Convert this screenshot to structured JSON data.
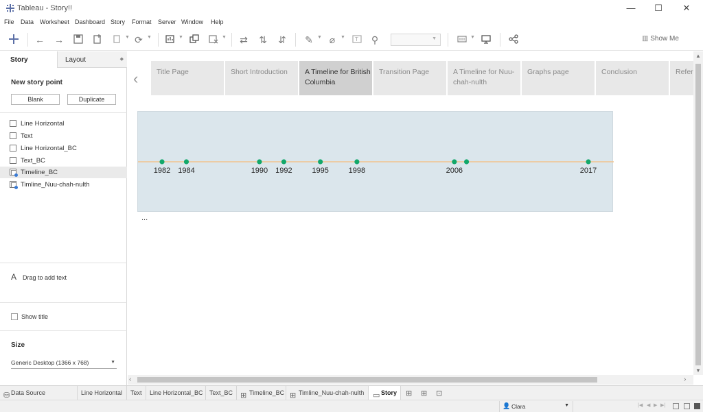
{
  "window": {
    "title": "Tableau - Story!!",
    "minimize": "—",
    "maximize": "☐",
    "close": "✕"
  },
  "menu": [
    "File",
    "Data",
    "Worksheet",
    "Dashboard",
    "Story",
    "Format",
    "Server",
    "Window",
    "Help"
  ],
  "toolbar": {
    "show_me_label": "Show Me",
    "icons": [
      "back-icon",
      "forward-icon",
      "save-icon",
      "new-data-source-icon",
      "pause-icon",
      "refresh-icon",
      "new-worksheet-icon",
      "duplicate-icon",
      "clear-icon",
      "swap-icon",
      "sort-ascending-icon",
      "sort-descending-icon",
      "highlight-icon",
      "annotate-icon",
      "label-icon",
      "fix-axes-icon",
      "fit-dropdown",
      "show-cards-icon",
      "presentation-icon",
      "share-icon"
    ]
  },
  "left_panel": {
    "tabs": {
      "story": "Story",
      "layout": "Layout"
    },
    "new_story_point": "New story point",
    "blank_button": "Blank",
    "duplicate_button": "Duplicate",
    "sheets": [
      {
        "label": "Line Horizontal",
        "kind": "worksheet",
        "selected": false
      },
      {
        "label": "Text",
        "kind": "worksheet",
        "selected": false
      },
      {
        "label": "Line Horizontal_BC",
        "kind": "worksheet",
        "selected": false
      },
      {
        "label": "Text_BC",
        "kind": "worksheet",
        "selected": false
      },
      {
        "label": "Timeline_BC",
        "kind": "dashboard",
        "selected": true
      },
      {
        "label": "Timline_Nuu-chah-nulth",
        "kind": "dashboard",
        "selected": false
      }
    ],
    "drag_text_icon": "A",
    "drag_text_label": "Drag to add text",
    "show_title_label": "Show title",
    "size_title": "Size",
    "size_value": "Generic Desktop (1366 x 768)"
  },
  "story": {
    "prev_arrow": "‹",
    "points": [
      {
        "label": "Title Page",
        "active": false
      },
      {
        "label": "Short Introduction",
        "active": false
      },
      {
        "label": "A Timeline for British Columbia",
        "active": true
      },
      {
        "label": "Transition Page",
        "active": false
      },
      {
        "label": "A Timeline for Nuu-chah-nulth",
        "active": false
      },
      {
        "label": "Graphs page",
        "active": false
      },
      {
        "label": "Conclusion",
        "active": false
      },
      {
        "label": "Refere",
        "active": false
      }
    ],
    "caption": "..."
  },
  "chart_data": {
    "type": "scatter",
    "title": "",
    "x": [
      1982,
      1984,
      1990,
      1992,
      1995,
      1998,
      2006,
      2007,
      2017
    ],
    "labels": [
      "1982",
      "1984",
      "1990",
      "1992",
      "1995",
      "1998",
      "2006",
      "",
      "2017"
    ],
    "xlim": [
      1980,
      2019
    ],
    "grid": false,
    "colors": {
      "background": "#dbe6ec",
      "line": "#f2c48d",
      "point": "#13a86b"
    }
  },
  "bottom_tabs": [
    {
      "label": "Data Source",
      "icon": "database-icon",
      "active": false
    },
    {
      "label": "Line Horizontal",
      "icon": "",
      "active": false
    },
    {
      "label": "Text",
      "icon": "",
      "active": false
    },
    {
      "label": "Line Horizontal_BC",
      "icon": "",
      "active": false
    },
    {
      "label": "Text_BC",
      "icon": "",
      "active": false
    },
    {
      "label": "Timeline_BC",
      "icon": "dashboard-icon",
      "active": false
    },
    {
      "label": "Timline_Nuu-chah-nulth",
      "icon": "dashboard-icon",
      "active": false
    },
    {
      "label": "Story",
      "icon": "story-icon",
      "active": true
    }
  ],
  "status": {
    "user": "Clara"
  }
}
